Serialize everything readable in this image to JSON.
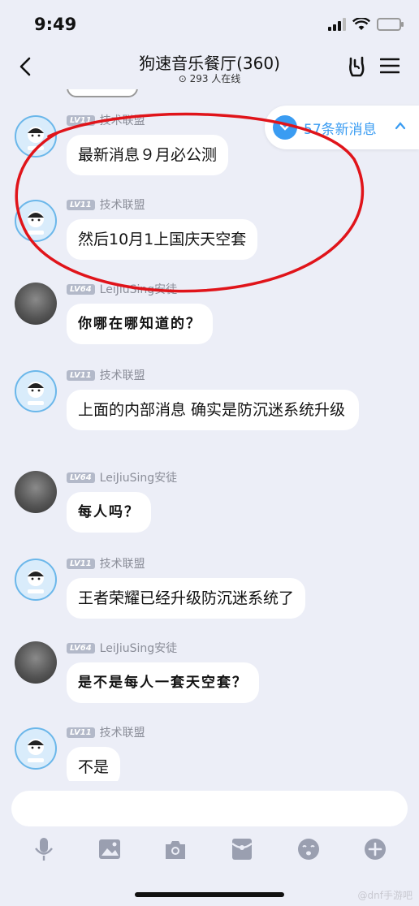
{
  "status": {
    "time": "9:49"
  },
  "header": {
    "title": "狗速音乐餐厅(360)",
    "online": "293 人在线"
  },
  "new_messages": {
    "label": "57条新消息"
  },
  "messages": [
    {
      "sender": "技术联盟",
      "level": "LV11",
      "text": "最新消息９月必公测",
      "avatar": "tech"
    },
    {
      "sender": "技术联盟",
      "level": "LV11",
      "text": "然后10月1上国庆天空套",
      "avatar": "tech"
    },
    {
      "sender": "LeiJiuSing安徒",
      "level": "LV64",
      "text": "你哪在哪知道的？",
      "avatar": "cat"
    },
    {
      "sender": "技术联盟",
      "level": "LV11",
      "text": "上面的内部消息  确实是防沉迷系统升级",
      "avatar": "tech"
    },
    {
      "sender": "LeiJiuSing安徒",
      "level": "LV64",
      "text": "每人吗？",
      "avatar": "cat"
    },
    {
      "sender": "技术联盟",
      "level": "LV11",
      "text": "王者荣耀已经升级防沉迷系统了",
      "avatar": "tech"
    },
    {
      "sender": "LeiJiuSing安徒",
      "level": "LV64",
      "text": "是不是每人一套天空套？",
      "avatar": "cat"
    },
    {
      "sender": "技术联盟",
      "level": "LV11",
      "text": "不是",
      "avatar": "tech"
    }
  ],
  "input": {
    "placeholder": ""
  },
  "toolbar": [
    "mic-icon",
    "image-icon",
    "camera-icon",
    "red-packet-icon",
    "emoji-icon",
    "plus-icon"
  ],
  "watermark": "@dnf手游吧",
  "colors": {
    "accent": "#3a9cf2",
    "annotation": "#e0141a",
    "background": "#eceef7"
  }
}
